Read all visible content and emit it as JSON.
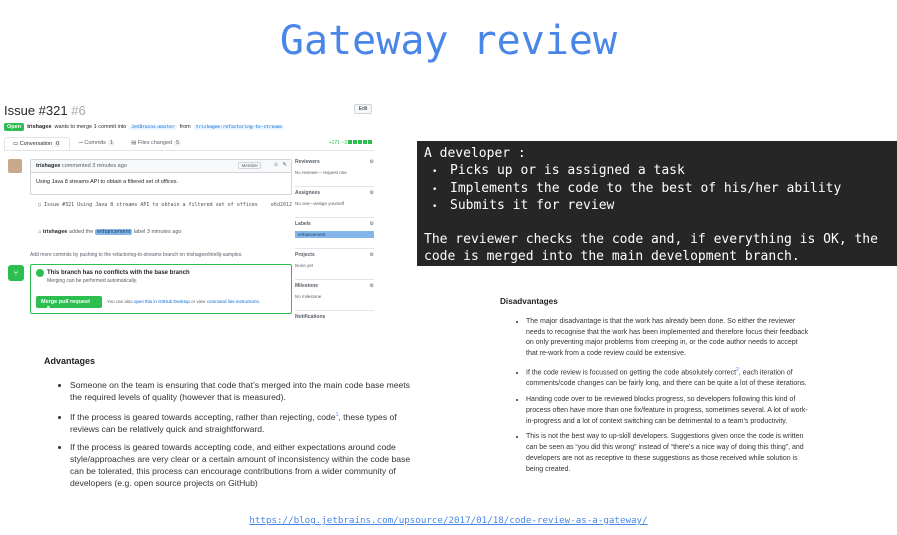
{
  "slide": {
    "title": "Gateway review",
    "source_url": "https://blog.jetbrains.com/upsource/2017/01/18/code-review-as-a-gateway/"
  },
  "issue": {
    "title": "Issue #321",
    "number": "#6",
    "edit_label": "Edit",
    "status": "Open",
    "author": "trishagee",
    "meta_text": "wants to merge 1 commit into",
    "base_branch": "JetBrains:master",
    "from_text": "from",
    "head_branch": "trishagee:refactoring-to-streams",
    "tabs": [
      {
        "label": "Conversation",
        "count": "0"
      },
      {
        "label": "Commits",
        "count": "1"
      },
      {
        "label": "Files changed",
        "count": "5"
      }
    ],
    "diffstat": "+171 −3",
    "comment": {
      "author": "trishagee",
      "time": "commented 3 minutes ago",
      "role": "Member",
      "body": "Using Java 8 streams API to obtain a filtered set of offices."
    },
    "commit": {
      "message": "Issue #321 Using Java 8 streams API to obtain a filtered set of offices",
      "sha": "e6d2012"
    },
    "label_event": {
      "author": "trishagee",
      "action": "added the",
      "label": "enhancement",
      "suffix": "label 3 minutes ago"
    },
    "push_note": "Add more commits by pushing to the refactoring-to-streams branch on trishagee/intellij-samples.",
    "merge": {
      "title": "This branch has no conflicts with the base branch",
      "subtitle": "Merging can be performed automatically.",
      "button": "Merge pull request",
      "alt_prefix": "You can also",
      "alt_link1": "open this in GitHub Desktop",
      "alt_mid": "or view",
      "alt_link2": "command line instructions."
    },
    "sidebar": [
      {
        "heading": "Reviewers",
        "value": "No reviews— request one"
      },
      {
        "heading": "Assignees",
        "value": "No one—assign yourself"
      },
      {
        "heading": "Labels",
        "value": "enhancement"
      },
      {
        "heading": "Projects",
        "value": "None yet"
      },
      {
        "heading": "Milestone",
        "value": "No milestone"
      },
      {
        "heading": "Notifications",
        "value": ""
      }
    ]
  },
  "definition": {
    "intro": "A developer :",
    "bullets": [
      "Picks up or is assigned a task",
      "Implements the code to the best of his/her ability",
      "Submits it for review"
    ],
    "conclusion_line1": "The reviewer checks the code and, if everything is OK, the",
    "conclusion_line2": "code is merged into the main development branch."
  },
  "advantages": {
    "heading": "Advantages",
    "items": [
      "Someone on the team is ensuring that code that’s merged into the main code base meets the required levels of quality (however that is measured).",
      "If the process is geared towards accepting, rather than rejecting, code",
      "If the process is geared towards accepting code, and either expectations around code style/approaches are very clear or a certain amount of inconsistency within the code base can be tolerated, this process can encourage contributions from a wider community of developers (e.g. open source projects on GitHub)"
    ],
    "item2_sup": "1",
    "item2_tail": ", these types of reviews can be relatively quick and straightforward."
  },
  "disadvantages": {
    "heading": "Disadvantages",
    "items": [
      "The major disadvantage is that the work has already been done. So either the reviewer needs to recognise that the work has been implemented and therefore focus their feedback on only preventing major problems from creeping in, or the code author needs to accept that re-work from a code review could be extensive.",
      "If the code review is focussed on getting the code absolutely correct",
      "Handing code over to be reviewed blocks progress, so developers following this kind of process often have more than one fix/feature in progress, sometimes several. A lot of work-in-progress and a lot of context switching can be detrimental to a team’s productivity.",
      "This is not the best way to up-skill developers. Suggestions given once the code is written can be seen as “you did this wrong” instead of “there’s a nice way of doing this thing”, and developers are not as receptive to these suggestions as those received while solution is being created."
    ],
    "item2_sup": "2",
    "item2_tail": ", each iteration of comments/code changes can be fairly long, and there can be quite a lot of these iterations."
  }
}
